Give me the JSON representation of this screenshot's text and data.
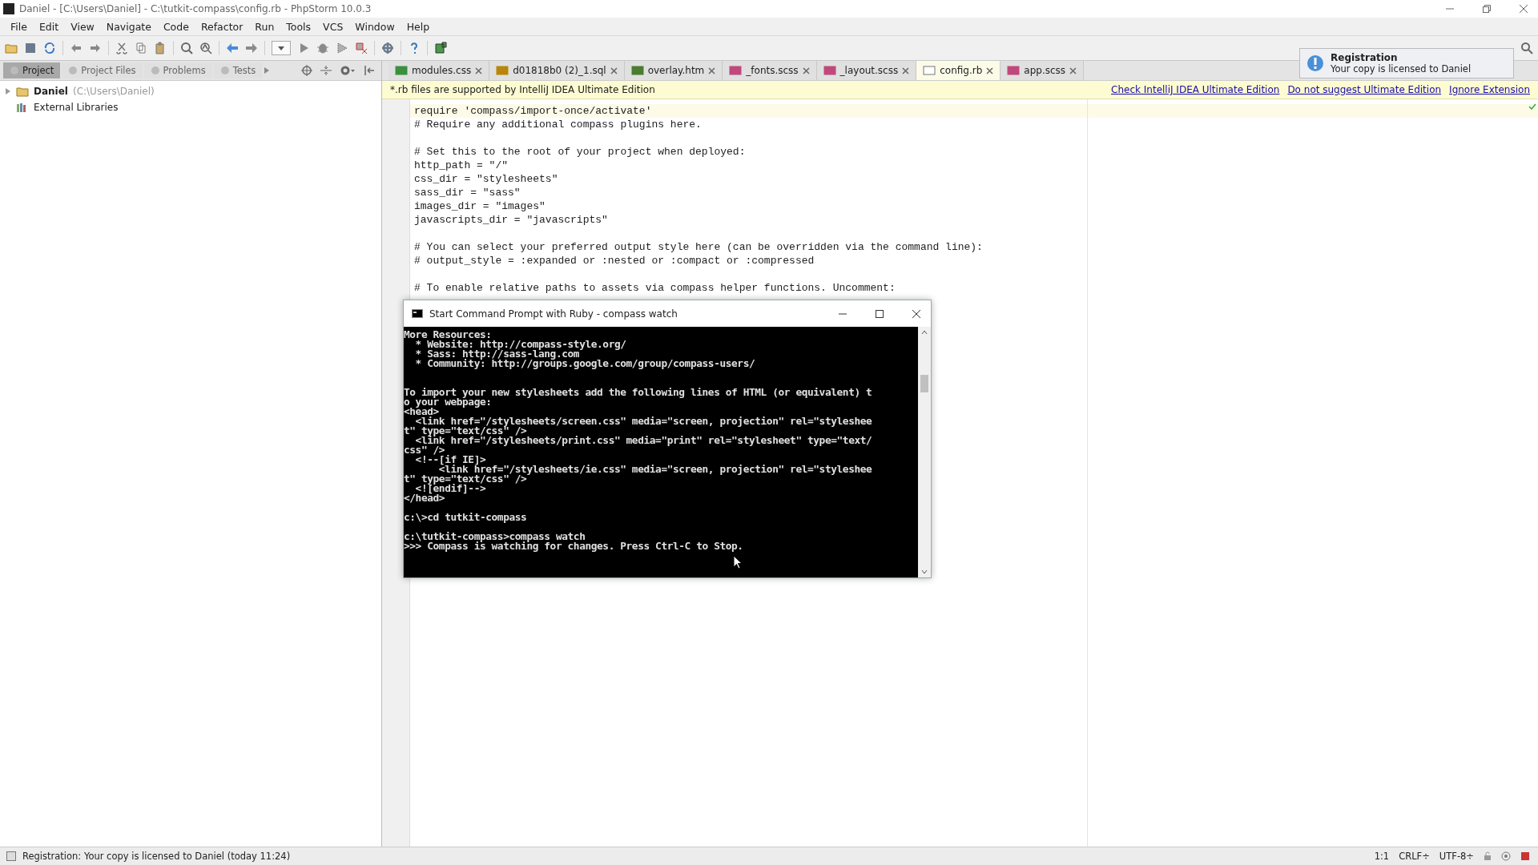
{
  "window": {
    "title": "Daniel - [C:\\Users\\Daniel] - C:\\tutkit-compass\\config.rb - PhpStorm 10.0.3"
  },
  "menu": [
    "File",
    "Edit",
    "View",
    "Navigate",
    "Code",
    "Refactor",
    "Run",
    "Tools",
    "VCS",
    "Window",
    "Help"
  ],
  "tool_tabs": [
    {
      "label": "Project",
      "selected": true
    },
    {
      "label": "Project Files",
      "selected": false
    },
    {
      "label": "Problems",
      "selected": false
    },
    {
      "label": "Tests",
      "selected": false
    }
  ],
  "tree": [
    {
      "label": "Daniel",
      "path": "(C:\\Users\\Daniel)",
      "kind": "folder"
    },
    {
      "label": "External Libraries",
      "kind": "library"
    }
  ],
  "tabs": [
    {
      "label": "modules.css",
      "kind": "css",
      "selected": false
    },
    {
      "label": "d01818b0 (2)_1.sql",
      "kind": "sql",
      "selected": false
    },
    {
      "label": "overlay.htm",
      "kind": "htm",
      "selected": false
    },
    {
      "label": "_fonts.scss",
      "kind": "sass",
      "selected": false
    },
    {
      "label": "_layout.scss",
      "kind": "sass",
      "selected": false
    },
    {
      "label": "config.rb",
      "kind": "rb",
      "selected": true
    },
    {
      "label": "app.scss",
      "kind": "sass",
      "selected": false
    }
  ],
  "banner": {
    "text": "*.rb files are supported by IntelliJ IDEA Ultimate Edition",
    "links": [
      "Check IntelliJ IDEA Ultimate Edition",
      "Do not suggest Ultimate Edition",
      "Ignore Extension"
    ]
  },
  "code": [
    [
      "require 'compass/import-once/activate'",
      "# Require any additional compass plugins here."
    ],
    [
      "# Set this to the root of your project when deployed:",
      "http_path = \"/\"",
      "css_dir = \"stylesheets\"",
      "sass_dir = \"sass\"",
      "images_dir = \"images\"",
      "javascripts_dir = \"javascripts\""
    ],
    [
      "# You can select your preferred output style here (can be overridden via the command line):",
      "# output_style = :expanded or :nested or :compact or :compressed"
    ],
    [
      "# To enable relative paths to assets via compass helper functions. Uncomment:"
    ]
  ],
  "notification": {
    "title": "Registration",
    "text": "Your copy is licensed to Daniel"
  },
  "terminal": {
    "title": "Start Command Prompt with Ruby - compass  watch",
    "blocks": [
      [
        "More Resources:",
        "  * Website: http://compass-style.org/",
        "  * Sass: http://sass-lang.com",
        "  * Community: http://groups.google.com/group/compass-users/"
      ],
      [
        "To import your new stylesheets add the following lines of HTML (or equivalent) t",
        "o your webpage:",
        "<head>",
        "  <link href=\"/stylesheets/screen.css\" media=\"screen, projection\" rel=\"styleshee",
        "t\" type=\"text/css\" />",
        "  <link href=\"/stylesheets/print.css\" media=\"print\" rel=\"stylesheet\" type=\"text/",
        "css\" />",
        "  <!--[if IE]>",
        "      <link href=\"/stylesheets/ie.css\" media=\"screen, projection\" rel=\"styleshee",
        "t\" type=\"text/css\" />",
        "  <![endif]-->",
        "</head>"
      ],
      [
        "c:\\>cd tutkit-compass"
      ],
      [
        "c:\\tutkit-compass>compass watch",
        ">>> Compass is watching for changes. Press Ctrl-C to Stop."
      ]
    ]
  },
  "status_bar": {
    "message": "Registration: Your copy is licensed to Daniel (today 11:24)",
    "position": "1:1",
    "line_separator": "CRLF÷",
    "encoding": "UTF-8÷"
  }
}
